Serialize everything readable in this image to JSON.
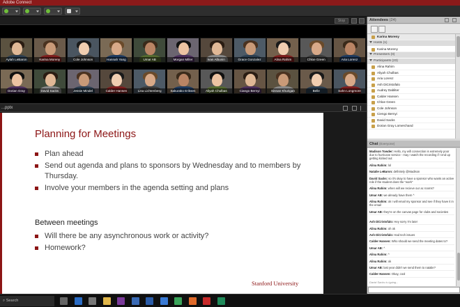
{
  "window": {
    "app_title": "Adobe Connect"
  },
  "colors": {
    "brand": "#8c1515",
    "titlebar": "#8b1a1a",
    "slide_bg": "#ffffff"
  },
  "toolbar": {
    "buttons": [
      {
        "name": "speaker-icon",
        "color": "#6fbf3a"
      },
      {
        "name": "microphone-icon",
        "color": "#6fbf3a"
      },
      {
        "name": "camera-icon",
        "color": "#6fbf3a"
      },
      {
        "name": "raise-hand-icon",
        "color": "#d8d8d8"
      }
    ]
  },
  "video_pod": {
    "stop_label": "Stop",
    "participants_row1": [
      "Aylah LeBaron",
      "Karina Moreny",
      "Cole Johnson",
      "Hannah Yang",
      "Umar AB",
      "Morgan Miller",
      "Ivan Albunin",
      "Grace Gonzalez",
      "Alina Rahim",
      "Chloe Green",
      "Aria Lorenz"
    ],
    "participants_row2": [
      "Dorian Gray",
      "David Sacks",
      "Jessie Mindel",
      "Calder Hansen",
      "Lisa Lichtenberg",
      "Sakurako Eriksen",
      "Aliyah Chulbas",
      "Ciango Bernyi",
      "Sinnan Khurigan",
      "Belle",
      "Sahn Longmore"
    ]
  },
  "share_pod": {
    "title": "...pptx",
    "slide": {
      "title": "Planning for Meetings",
      "bullets": [
        "Plan ahead",
        "Send out agenda and plans to sponsors by Wednesday and to members by Thursday.",
        "Involve your members in the agenda setting and plans"
      ],
      "section_heading": "Between meetings",
      "section_bullets": [
        "Will there be any asynchronous work or activity?",
        "Homework?"
      ],
      "footer_logo": "Stanford University"
    }
  },
  "attendees": {
    "title": "Attendees",
    "count": "(24)",
    "host_self": "Karina Moreny",
    "groups": [
      {
        "label": "Hosts (1)",
        "members": [
          "Karina Moreny"
        ]
      },
      {
        "label": "Presenters (0)",
        "members": []
      },
      {
        "label": "Participants (23)",
        "members": [
          "Alina Rahim",
          "Aliyah Chulbas",
          "Aria Lorenz",
          "Ash DiCristofalo",
          "Audrey Dabliter",
          "Calder Hansen",
          "Chloe Green",
          "Cole Johnson",
          "Ciengo Bernyi",
          "David Sacks",
          "Dorian Gray Lomerchand"
        ]
      }
    ]
  },
  "chat": {
    "title": "Chat",
    "scope": "(Everyone)",
    "messages": [
      {
        "user": "Madison Towder:",
        "text": "Hello, my wifi connection is extremely poor due to hurricane service - may I watch the recording if I end up getting kicked out"
      },
      {
        "user": "Alina Rahim:",
        "text": "lol"
      },
      {
        "user": "Natalie LeBaron:",
        "text": "definitely @Madison"
      },
      {
        "user": "David Sacks:",
        "text": "so it's okay to have a sponsor who wants an active role if the student does the \"work\""
      },
      {
        "user": "Alina Rahim:",
        "text": "when will we recieve our ac rooms?"
      },
      {
        "user": "Umar AB:",
        "text": "we already have them ^"
      },
      {
        "user": "Alina Rahim:",
        "text": "ok I will email my sponsor and see if they have it in the email"
      },
      {
        "user": "Umar AB:",
        "text": "they're on the canvas page for clubs and societies"
      },
      {
        "user": "Ash DiCristofalo:",
        "text": "Hey sorry I'm late!"
      },
      {
        "user": "Alina Rahim:",
        "text": "oh ok"
      },
      {
        "user": "Ash DiCristofalo:",
        "text": "Had tech issues"
      },
      {
        "user": "Calder Hansen:",
        "text": "Who should we send the meeting dates to?"
      },
      {
        "user": "Umar AB:",
        "text": "^"
      },
      {
        "user": "Alina Rahim:",
        "text": "^"
      },
      {
        "user": "Alina Rahim:",
        "text": "ok"
      },
      {
        "user": "Umar AB:",
        "text": "last year didn't we send them to natalie?"
      },
      {
        "user": "Calder Hansen:",
        "text": "Okay, cool"
      }
    ],
    "typing": "David Sacks is typing...",
    "target": "Everyone"
  },
  "taskbar": {
    "search_placeholder": "Search",
    "apps": [
      {
        "name": "task-view-icon",
        "color": "#666666"
      },
      {
        "name": "edge-icon",
        "color": "#2b6cc4"
      },
      {
        "name": "camera-app-icon",
        "color": "#777777"
      },
      {
        "name": "folder-icon",
        "color": "#e0b64a"
      },
      {
        "name": "onenote-icon",
        "color": "#7a3a9a"
      },
      {
        "name": "store-icon",
        "color": "#3a6ab4"
      },
      {
        "name": "word-icon",
        "color": "#2b5ca8"
      },
      {
        "name": "mail-icon",
        "color": "#3a7ad4"
      },
      {
        "name": "chrome-icon",
        "color": "#3aa45a"
      },
      {
        "name": "firefox-icon",
        "color": "#e06a2a"
      },
      {
        "name": "adobe-icon",
        "color": "#c82a2a"
      },
      {
        "name": "connect-icon",
        "color": "#1f8a5a"
      }
    ]
  }
}
